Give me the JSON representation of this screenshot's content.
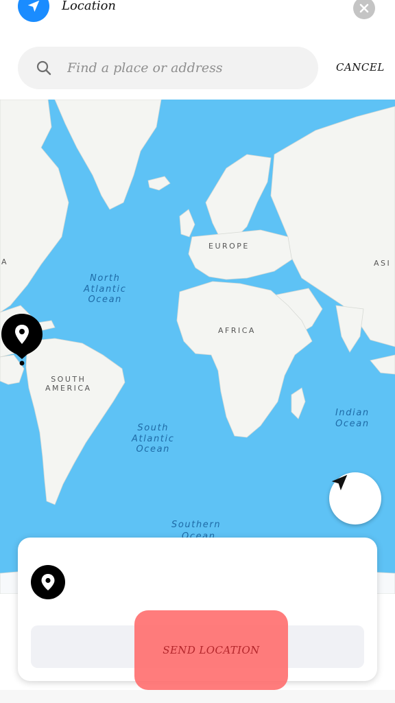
{
  "header": {
    "title": "Location",
    "app_icon": "navigation-arrow-icon",
    "close_icon": "close-icon",
    "accent_color": "#1a8cff"
  },
  "search": {
    "placeholder": "Find a place or address",
    "value": "",
    "icon": "search-icon",
    "cancel_label": "CANCEL"
  },
  "map": {
    "water_color": "#5ec2f5",
    "land_color": "#f4f5f2",
    "labels": {
      "europe": "EUROPE",
      "africa": "AFRICA",
      "asia_fragment": "ASI",
      "americas_fragment": "A",
      "south_america": "SOUTH\nAMERICA",
      "north_atlantic": "North\nAtlantic\nOcean",
      "south_atlantic": "South\nAtlantic\nOcean",
      "indian_ocean": "Indian\nOcean",
      "southern_ocean": "Southern",
      "southern_ocean_fragment": "Ocean"
    },
    "pin_icon": "map-pin-icon",
    "locate_icon": "locate-arrow-icon"
  },
  "sheet": {
    "pin_icon": "map-pin-icon",
    "send_label": "SEND LOCATION",
    "send_color": "#ff6a6a"
  }
}
